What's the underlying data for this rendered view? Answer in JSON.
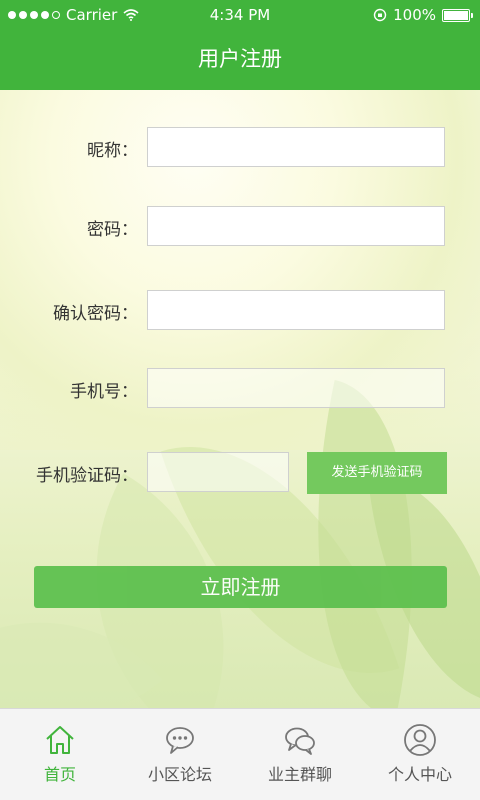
{
  "status_bar": {
    "carrier": "Carrier",
    "time": "4:34 PM",
    "battery": "100%"
  },
  "header": {
    "title": "用户注册"
  },
  "form": {
    "nickname_label": "昵称：",
    "password_label": "密码：",
    "confirm_password_label": "确认密码：",
    "phone_label": "手机号：",
    "code_label": "手机验证码：",
    "nickname_value": "",
    "password_value": "",
    "confirm_password_value": "",
    "phone_value": "",
    "code_value": "",
    "send_code_label": "发送手机验证码",
    "submit_label": "立即注册"
  },
  "tabbar": {
    "items": [
      {
        "label": "首页",
        "icon": "home-icon",
        "active": true
      },
      {
        "label": "小区论坛",
        "icon": "chat-bubble-icon",
        "active": false
      },
      {
        "label": "业主群聊",
        "icon": "group-chat-icon",
        "active": false
      },
      {
        "label": "个人中心",
        "icon": "user-icon",
        "active": false
      }
    ]
  },
  "colors": {
    "brand_green": "#41b43c",
    "button_green": "#74c95e",
    "submit_green": "#5abf4c"
  }
}
